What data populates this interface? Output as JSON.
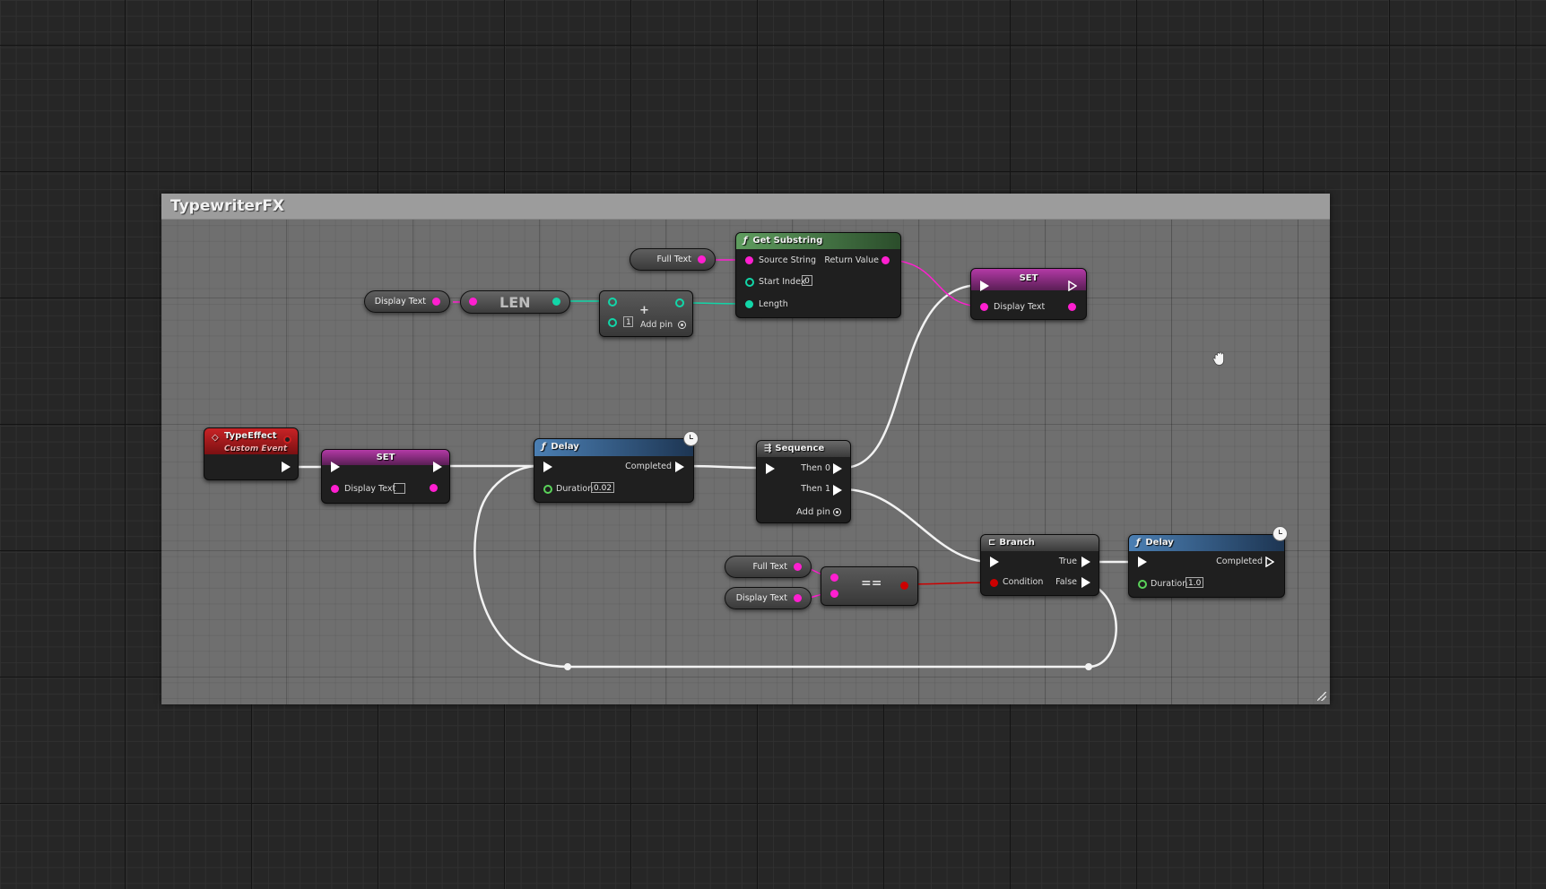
{
  "comment": {
    "title": "TypewriterFX"
  },
  "nodes": {
    "custom_event": {
      "title": "TypeEffect",
      "subtitle": "Custom Event"
    },
    "set_reset": {
      "title": "SET",
      "pin_display_text": "Display Text"
    },
    "delay_short": {
      "title": "Delay",
      "pin_completed": "Completed",
      "pin_duration": "Duration",
      "duration": "0.02"
    },
    "sequence": {
      "title": "Sequence",
      "pin_then0": "Then 0",
      "pin_then1": "Then 1",
      "add_pin": "Add pin"
    },
    "branch": {
      "title": "Branch",
      "pin_true": "True",
      "pin_condition": "Condition",
      "pin_false": "False"
    },
    "delay_long": {
      "title": "Delay",
      "pin_completed": "Completed",
      "pin_duration": "Duration",
      "duration": "1.0"
    },
    "get_substring": {
      "title": "Get Substring",
      "pin_source": "Source String",
      "pin_return": "Return Value",
      "pin_start_index": "Start Index",
      "start_index": "0",
      "pin_length": "Length"
    },
    "set_display": {
      "title": "SET",
      "pin_display_text": "Display Text"
    },
    "len": {
      "title": "LEN"
    },
    "add": {
      "symbol": "+",
      "value": "1",
      "add_pin": "Add pin"
    },
    "equal": {
      "symbol": "=="
    },
    "var_full_text_top": {
      "label": "Full Text"
    },
    "var_display_text_top": {
      "label": "Display Text"
    },
    "var_full_text_bottom": {
      "label": "Full Text"
    },
    "var_display_text_bottom": {
      "label": "Display Text"
    }
  },
  "colors": {
    "string_pin": "#ff1fd0",
    "int_pin": "#12d6a8",
    "float_pin": "#5ad35a",
    "bool_pin": "#cc0000",
    "event_header": "#a8191b",
    "set_header": "#9b2c8f",
    "function_header": "#3f6f9c",
    "pure_header": "#4f8f4f",
    "macro_header": "#5a5a5a"
  }
}
